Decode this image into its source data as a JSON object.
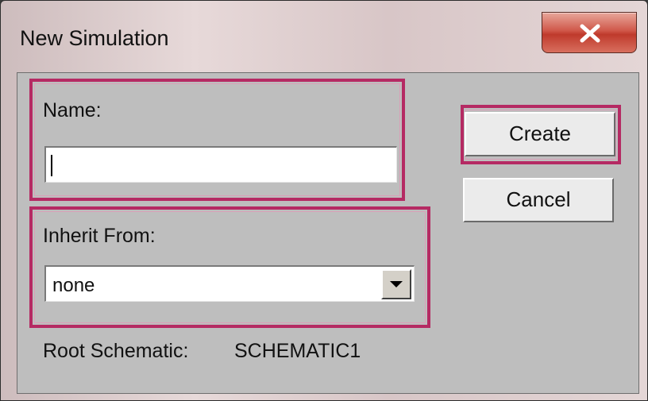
{
  "window": {
    "title": "New Simulation"
  },
  "form": {
    "name_label": "Name:",
    "name_value": "",
    "inherit_label": "Inherit From:",
    "inherit_value": "none",
    "root_label": "Root Schematic:",
    "root_value": "SCHEMATIC1"
  },
  "buttons": {
    "create": "Create",
    "cancel": "Cancel"
  },
  "colors": {
    "highlight": "#b52a63",
    "close_button": "#c9463a",
    "dialog_face": "#bebebe"
  },
  "icons": {
    "close": "close-icon",
    "dropdown": "chevron-down-icon"
  }
}
